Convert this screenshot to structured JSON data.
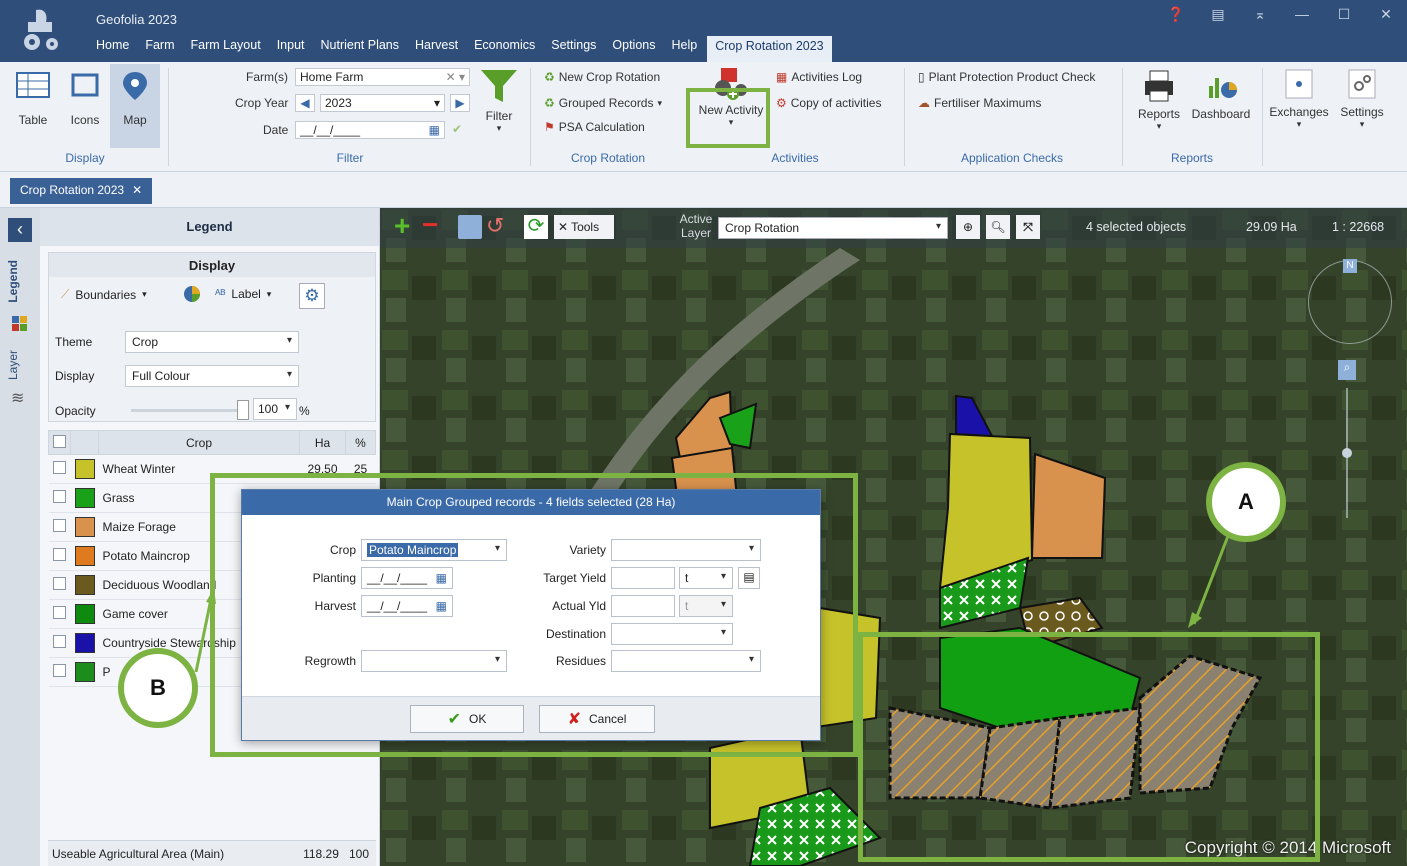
{
  "app": {
    "title": "Geofolia 2023",
    "menu": [
      "Home",
      "Farm",
      "Farm Layout",
      "Input",
      "Nutrient Plans",
      "Harvest",
      "Economics",
      "Settings",
      "Options",
      "Help"
    ],
    "active_tab": "Crop Rotation 2023"
  },
  "ribbon": {
    "display": {
      "table": "Table",
      "icons": "Icons",
      "map": "Map",
      "label": "Display"
    },
    "filter": {
      "farms_label": "Farm(s)",
      "farms_value": "Home Farm",
      "crop_year_label": "Crop Year",
      "crop_year_value": "2023",
      "date_label": "Date",
      "date_value": "__/__/____",
      "filter_button": "Filter",
      "label": "Filter"
    },
    "crop_rotation": {
      "new": "New Crop Rotation",
      "grouped": "Grouped Records",
      "psa": "PSA Calculation",
      "label": "Crop Rotation"
    },
    "activities": {
      "new_activity": "New Activity",
      "log": "Activities Log",
      "copy": "Copy of activities",
      "label": "Activities"
    },
    "application_checks": {
      "ppp": "Plant Protection Product Check",
      "fert": "Fertiliser Maximums",
      "label": "Application Checks"
    },
    "reports": {
      "reports": "Reports",
      "dashboard": "Dashboard",
      "label": "Reports"
    },
    "exchanges": "Exchanges",
    "settings": "Settings"
  },
  "doc_tab": "Crop Rotation 2023",
  "side_tabs": {
    "legend": "Legend",
    "layer": "Layer"
  },
  "legend": {
    "header": "Legend",
    "display_title": "Display",
    "boundaries": "Boundaries",
    "label": "Label",
    "theme_label": "Theme",
    "theme_value": "Crop",
    "display_label": "Display",
    "display_value": "Full Colour",
    "opacity_label": "Opacity",
    "opacity_value": "100",
    "opacity_unit": "%",
    "opacity_fraction": 1.0,
    "table_headers": {
      "crop": "Crop",
      "ha": "Ha",
      "pct": "%"
    },
    "rows": [
      {
        "crop": "Wheat Winter",
        "color": "#c6c22a",
        "ha": "29.50",
        "pct": "25"
      },
      {
        "crop": "Grass",
        "color": "#1aa11a",
        "ha": "",
        "pct": ""
      },
      {
        "crop": "Maize Forage",
        "color": "#d9924e",
        "ha": "",
        "pct": ""
      },
      {
        "crop": "Potato Maincrop",
        "color": "#e07a1f",
        "ha": "",
        "pct": ""
      },
      {
        "crop": "Deciduous Woodland",
        "color": "#6b5a1e",
        "ha": "",
        "pct": ""
      },
      {
        "crop": "Game cover",
        "color": "#0e8a0e",
        "ha": "",
        "pct": ""
      },
      {
        "crop": "Countryside Stewardship",
        "color": "#1a12a8",
        "ha": "",
        "pct": ""
      },
      {
        "crop": "P",
        "color": "#1c8c1c",
        "ha": "",
        "pct": ""
      }
    ],
    "footer_label": "Useable Agricultural Area (Main)",
    "footer_ha": "118.29",
    "footer_pct": "100"
  },
  "map": {
    "tools": "Tools",
    "active_layer_label": "Active Layer",
    "active_layer_value": "Crop Rotation",
    "selected": "4 selected objects",
    "area": "29.09 Ha",
    "scale": "1 : 22668",
    "north": "N",
    "copyright": "Copyright © 2014 Microsoft"
  },
  "dialog": {
    "title": "Main Crop Grouped records - 4 fields selected (28 Ha)",
    "crop_label": "Crop",
    "crop_value": "Potato Maincrop",
    "planting_label": "Planting",
    "planting_value": "__/__/____",
    "harvest_label": "Harvest",
    "harvest_value": "__/__/____",
    "regrowth_label": "Regrowth",
    "regrowth_value": "",
    "variety_label": "Variety",
    "variety_value": "",
    "target_yield_label": "Target Yield",
    "target_yield_value": "",
    "target_yield_unit": "t",
    "actual_yld_label": "Actual Yld",
    "actual_yld_value": "",
    "actual_yld_unit": "t",
    "destination_label": "Destination",
    "destination_value": "",
    "residues_label": "Residues",
    "residues_value": "",
    "ok": "OK",
    "cancel": "Cancel"
  },
  "callouts": {
    "a": "A",
    "b": "B"
  },
  "colors": {
    "accent": "#2f4f7a",
    "highlight": "#7cb342",
    "dialog_title": "#3b6aa8"
  }
}
